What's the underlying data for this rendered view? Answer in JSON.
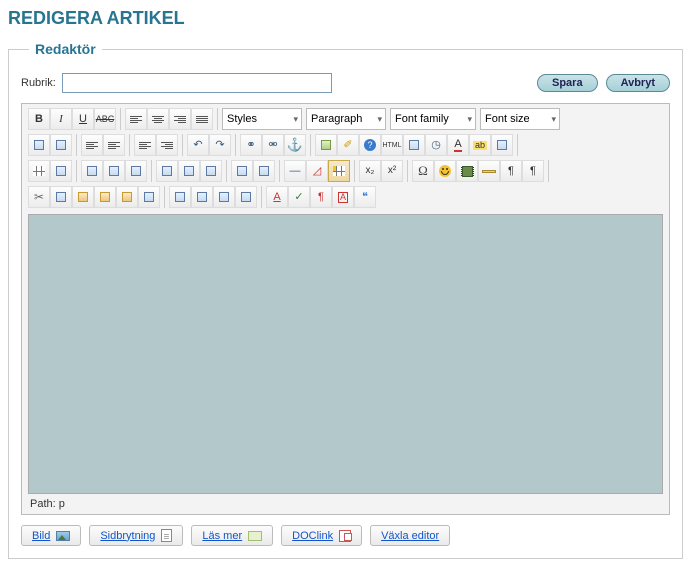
{
  "page_title": "REDIGERA ARTIKEL",
  "fieldset_legend": "Redaktör",
  "rubrik_label": "Rubrik:",
  "rubrik_value": "",
  "buttons": {
    "save": "Spara",
    "cancel": "Avbryt"
  },
  "selects": {
    "styles": "Styles",
    "paragraph": "Paragraph",
    "font_family": "Font family",
    "font_size": "Font size"
  },
  "path_label": "Path:",
  "path_value": "p",
  "bottom": {
    "image": "Bild",
    "pagebreak": "Sidbrytning",
    "readmore": "Läs mer",
    "doclink": "DOClink",
    "toggle_editor": "Växla editor"
  },
  "glyphs": {
    "bold": "B",
    "italic": "I",
    "underline": "U",
    "strike": "ABC",
    "anchor": "⚓",
    "omega": "Ω",
    "pilcrow": "¶",
    "pilcrow_rtl": "¶",
    "sub": "x₂",
    "sup": "x²",
    "quote": "❝",
    "scissors": "✂",
    "undo": "↶",
    "redo": "↷",
    "hr": "—",
    "help": "?",
    "html": "HTML",
    "clock": "◷",
    "A_color": "A",
    "A_find": "A",
    "abbr": "A͟",
    "ab_hl": "ab",
    "date": "▦",
    "layer": "▭",
    "check": "✓",
    "link": "⚭",
    "unlink": "⚮",
    "fullscreen": "⛶"
  }
}
